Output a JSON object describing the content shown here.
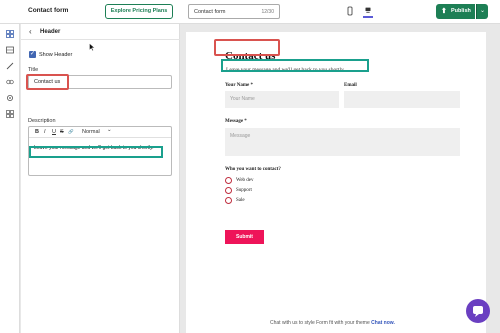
{
  "topbar": {
    "title": "Contact form",
    "pricing_label": "Explore Pricing Plans",
    "title_input_value": "Contact form",
    "char_count": "12/30",
    "publish_label": "Publish"
  },
  "panel": {
    "header": "Header",
    "show_header_label": "Show Header",
    "title_label": "Title",
    "title_value": "Contact us",
    "description_label": "Description",
    "toolbar": [
      "B",
      "I",
      "U",
      "S",
      "🔗",
      "Normal",
      "⌄"
    ],
    "description_value": "Leave your message and we'll get back to you shortly."
  },
  "form": {
    "title": "Contact us",
    "subtitle": "Leave your message and we'll get back to you shortly.",
    "name_label": "Your Name *",
    "name_placeholder": "Your Name",
    "email_label": "Email",
    "message_label": "Message *",
    "message_placeholder": "Message",
    "contact_question": "Who you want to contact?",
    "options": [
      "Web dev",
      "Support",
      "Sale"
    ],
    "submit_label": "Submit"
  },
  "footer": {
    "text": "Chat with us to style Form fit with your theme",
    "link": "Chat now."
  },
  "colors": {
    "brand_green": "#1d7f55",
    "submit_pink": "#ee1459",
    "highlight_red": "#d9534f",
    "highlight_teal": "#1aa08d",
    "chat_purple": "#6a3fc1"
  }
}
